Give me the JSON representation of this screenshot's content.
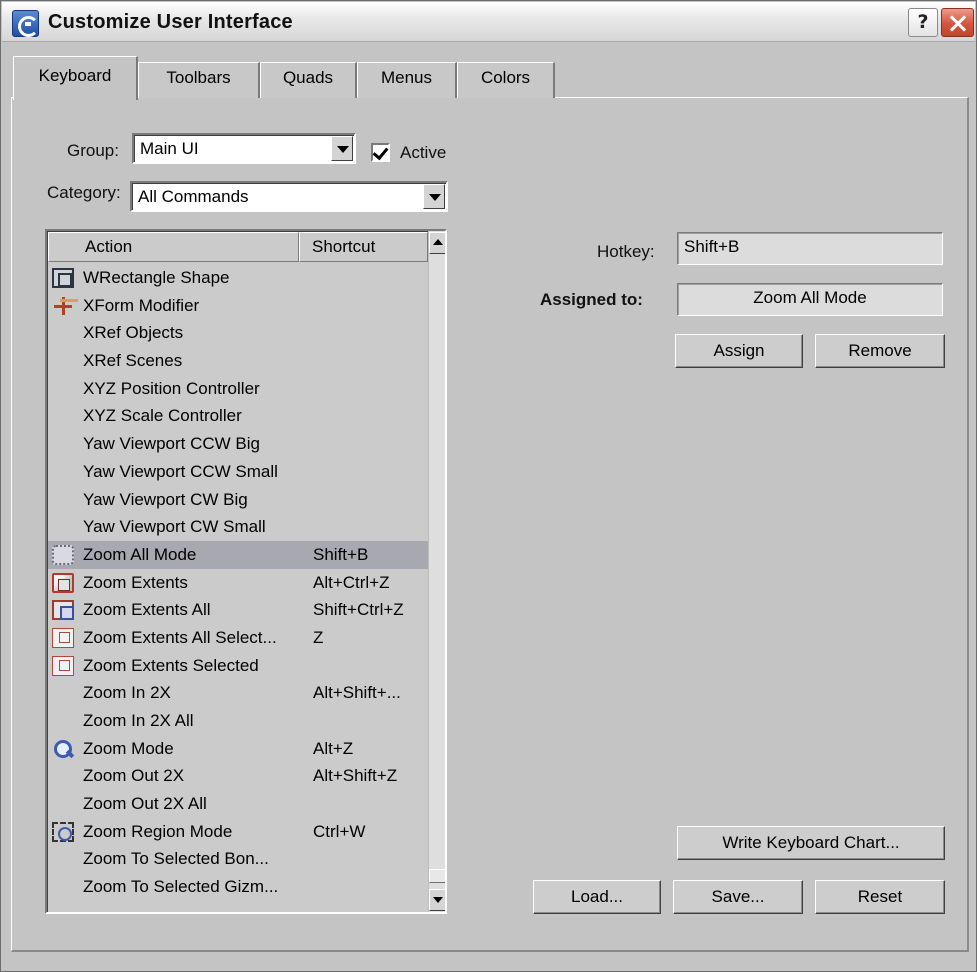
{
  "window": {
    "title": "Customize User Interface",
    "help_label": "?"
  },
  "tabs": [
    {
      "label": "Keyboard"
    },
    {
      "label": "Toolbars"
    },
    {
      "label": "Quads"
    },
    {
      "label": "Menus"
    },
    {
      "label": "Colors"
    }
  ],
  "active_tab": "Keyboard",
  "group": {
    "label": "Group:",
    "value": "Main UI"
  },
  "active_checkbox": {
    "label": "Active",
    "checked": true
  },
  "category": {
    "label": "Category:",
    "value": "All Commands"
  },
  "list": {
    "columns": {
      "action": "Action",
      "shortcut": "Shortcut"
    },
    "rows": [
      {
        "action": "WRectangle Shape",
        "shortcut": "",
        "icon": "rectangle-shape-icon"
      },
      {
        "action": "XForm Modifier",
        "shortcut": "",
        "icon": "xform-modifier-icon"
      },
      {
        "action": "XRef Objects",
        "shortcut": "",
        "icon": ""
      },
      {
        "action": "XRef Scenes",
        "shortcut": "",
        "icon": ""
      },
      {
        "action": "XYZ Position Controller",
        "shortcut": "",
        "icon": ""
      },
      {
        "action": "XYZ Scale Controller",
        "shortcut": "",
        "icon": ""
      },
      {
        "action": "Yaw Viewport CCW Big",
        "shortcut": "",
        "icon": ""
      },
      {
        "action": "Yaw Viewport CCW Small",
        "shortcut": "",
        "icon": ""
      },
      {
        "action": "Yaw Viewport CW Big",
        "shortcut": "",
        "icon": ""
      },
      {
        "action": "Yaw Viewport CW Small",
        "shortcut": "",
        "icon": ""
      },
      {
        "action": "Zoom All Mode",
        "shortcut": "Shift+B",
        "icon": "zoom-all-mode-icon",
        "selected": true
      },
      {
        "action": "Zoom Extents",
        "shortcut": "Alt+Ctrl+Z",
        "icon": "zoom-extents-icon"
      },
      {
        "action": "Zoom Extents All",
        "shortcut": "Shift+Ctrl+Z",
        "icon": "zoom-extents-all-icon"
      },
      {
        "action": "Zoom Extents All Select...",
        "shortcut": "Z",
        "icon": "zoom-extents-all-selected-icon"
      },
      {
        "action": "Zoom Extents Selected",
        "shortcut": "",
        "icon": "zoom-extents-selected-icon"
      },
      {
        "action": "Zoom In 2X",
        "shortcut": "Alt+Shift+...",
        "icon": ""
      },
      {
        "action": "Zoom In 2X All",
        "shortcut": "",
        "icon": ""
      },
      {
        "action": "Zoom Mode",
        "shortcut": "Alt+Z",
        "icon": "magnifier-icon"
      },
      {
        "action": "Zoom Out 2X",
        "shortcut": "Alt+Shift+Z",
        "icon": ""
      },
      {
        "action": "Zoom Out 2X All",
        "shortcut": "",
        "icon": ""
      },
      {
        "action": "Zoom Region Mode",
        "shortcut": "Ctrl+W",
        "icon": "zoom-region-icon"
      },
      {
        "action": "Zoom To Selected Bon...",
        "shortcut": "",
        "icon": ""
      },
      {
        "action": "Zoom To Selected Gizm...",
        "shortcut": "",
        "icon": ""
      }
    ]
  },
  "hotkey": {
    "label": "Hotkey:",
    "value": "Shift+B"
  },
  "assigned_to": {
    "label": "Assigned to:",
    "value": "Zoom All Mode"
  },
  "buttons": {
    "assign": "Assign",
    "remove": "Remove",
    "write_chart": "Write Keyboard Chart...",
    "load": "Load...",
    "save": "Save...",
    "reset": "Reset"
  }
}
